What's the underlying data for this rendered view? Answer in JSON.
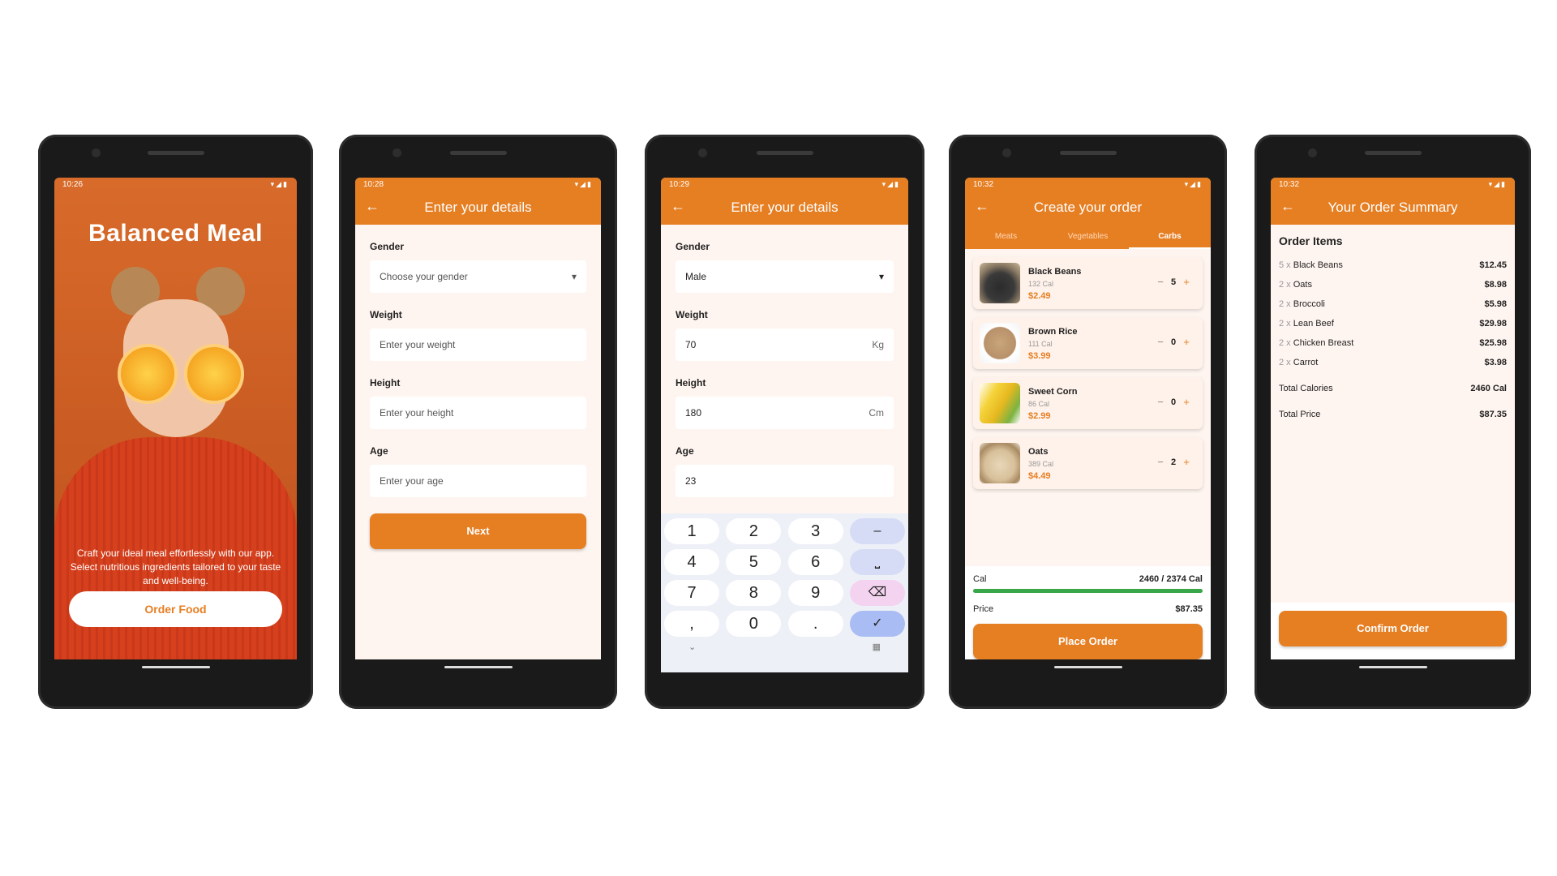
{
  "screen1": {
    "status_time": "10:26",
    "title": "Balanced Meal",
    "description": "Craft your ideal meal effortlessly with our app. Select nutritious ingredients tailored to your taste and well-being.",
    "cta": "Order Food"
  },
  "screen2": {
    "status_time": "10:28",
    "title": "Enter your details",
    "gender_label": "Gender",
    "gender_placeholder": "Choose your gender",
    "weight_label": "Weight",
    "weight_placeholder": "Enter your weight",
    "height_label": "Height",
    "height_placeholder": "Enter your height",
    "age_label": "Age",
    "age_placeholder": "Enter your age",
    "next": "Next"
  },
  "screen3": {
    "status_time": "10:29",
    "title": "Enter your details",
    "gender_label": "Gender",
    "gender_value": "Male",
    "weight_label": "Weight",
    "weight_value": "70",
    "weight_unit": "Kg",
    "height_label": "Height",
    "height_value": "180",
    "height_unit": "Cm",
    "age_label": "Age",
    "age_value": "23",
    "keys": [
      "1",
      "2",
      "3",
      "–",
      "4",
      "5",
      "6",
      "⎵",
      "7",
      "8",
      "9",
      "⌫",
      ",",
      "0",
      ".",
      "✓"
    ]
  },
  "screen4": {
    "status_time": "10:32",
    "title": "Create your order",
    "tabs": [
      "Meats",
      "Vegetables",
      "Carbs"
    ],
    "items": [
      {
        "name": "Black Beans",
        "cal": "132 Cal",
        "price": "$2.49",
        "qty": "5"
      },
      {
        "name": "Brown Rice",
        "cal": "111 Cal",
        "price": "$3.99",
        "qty": "0"
      },
      {
        "name": "Sweet Corn",
        "cal": "86 Cal",
        "price": "$2.99",
        "qty": "0"
      },
      {
        "name": "Oats",
        "cal": "389 Cal",
        "price": "$4.49",
        "qty": "2"
      }
    ],
    "cal_label": "Cal",
    "cal_value": "2460 / 2374 Cal",
    "cal_progress": 1.0,
    "price_label": "Price",
    "price_value": "$87.35",
    "place_order": "Place Order"
  },
  "screen5": {
    "status_time": "10:32",
    "title": "Your Order Summary",
    "heading": "Order Items",
    "items": [
      {
        "qty": "5 x",
        "name": "Black Beans",
        "amount": "$12.45"
      },
      {
        "qty": "2 x",
        "name": "Oats",
        "amount": "$8.98"
      },
      {
        "qty": "2 x",
        "name": "Broccoli",
        "amount": "$5.98"
      },
      {
        "qty": "2 x",
        "name": "Lean Beef",
        "amount": "$29.98"
      },
      {
        "qty": "2 x",
        "name": "Chicken Breast",
        "amount": "$25.98"
      },
      {
        "qty": "2 x",
        "name": "Carrot",
        "amount": "$3.98"
      }
    ],
    "total_cal_label": "Total Calories",
    "total_cal_value": "2460 Cal",
    "total_price_label": "Total Price",
    "total_price_value": "$87.35",
    "confirm": "Confirm Order"
  },
  "colors": {
    "accent": "#e67e22",
    "progress": "#3aa64a"
  }
}
